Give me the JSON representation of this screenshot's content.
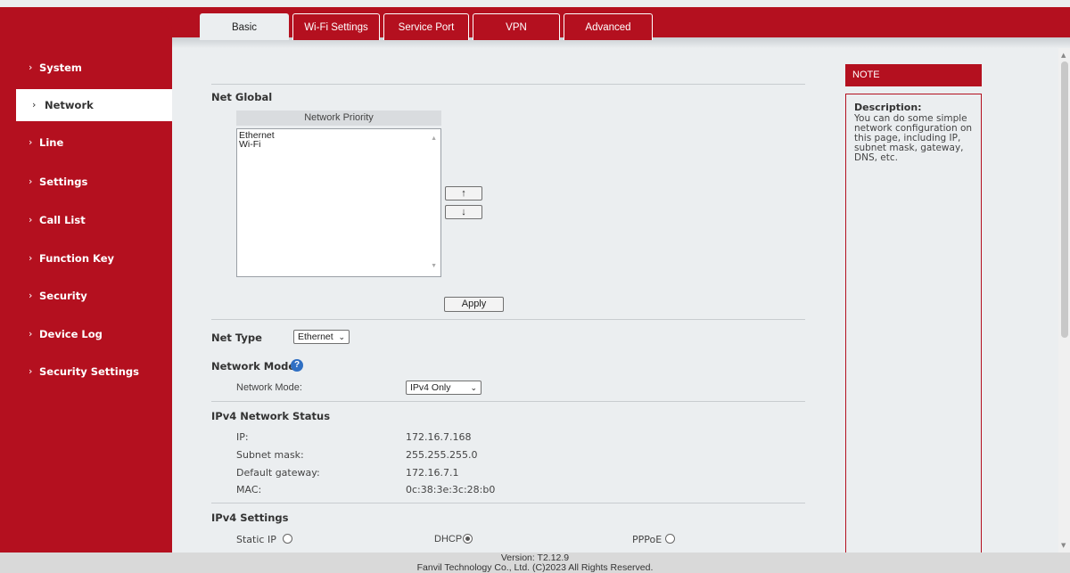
{
  "tabs": [
    {
      "label": "Basic",
      "active": true
    },
    {
      "label": "Wi-Fi Settings"
    },
    {
      "label": "Service Port"
    },
    {
      "label": "VPN"
    },
    {
      "label": "Advanced"
    }
  ],
  "sidebar": {
    "items": [
      {
        "label": "System"
      },
      {
        "label": "Network",
        "active": true
      },
      {
        "label": "Line"
      },
      {
        "label": "Settings"
      },
      {
        "label": "Call List"
      },
      {
        "label": "Function Key"
      },
      {
        "label": "Security"
      },
      {
        "label": "Device Log"
      },
      {
        "label": "Security Settings"
      }
    ]
  },
  "net_global": {
    "title": "Net Global",
    "priority_header": "Network Priority",
    "priority_options": [
      "Ethernet",
      "Wi-Fi"
    ],
    "up_label": "↑",
    "down_label": "↓",
    "apply_label": "Apply"
  },
  "net_type": {
    "title": "Net Type",
    "value": "Ethernet"
  },
  "network_mode": {
    "title": "Network Mode",
    "help_icon": "?",
    "field_label": "Network Mode:",
    "value": "IPv4 Only"
  },
  "ipv4_status": {
    "title": "IPv4 Network Status",
    "rows": [
      {
        "label": "IP:",
        "value": "172.16.7.168"
      },
      {
        "label": "Subnet mask:",
        "value": "255.255.255.0"
      },
      {
        "label": "Default gateway:",
        "value": "172.16.7.1"
      },
      {
        "label": "MAC:",
        "value": "0c:38:3e:3c:28:b0"
      }
    ]
  },
  "ipv4_settings": {
    "title": "IPv4 Settings",
    "options": [
      {
        "label": "Static IP",
        "checked": false
      },
      {
        "label": "DHCP",
        "checked": true
      },
      {
        "label": "PPPoE",
        "checked": false
      }
    ]
  },
  "note": {
    "header": "NOTE",
    "desc_title": "Description:",
    "desc_text": "You can do some simple network configuration on this page, including IP, subnet mask, gateway, DNS, etc."
  },
  "footer": {
    "version": "Version: T2.12.9",
    "copyright": "Fanvil Technology Co., Ltd. (C)2023 All Rights Reserved."
  },
  "colors": {
    "brand_red": "#b4101f",
    "background": "#ebeef0",
    "help_blue": "#2f6fc3"
  }
}
